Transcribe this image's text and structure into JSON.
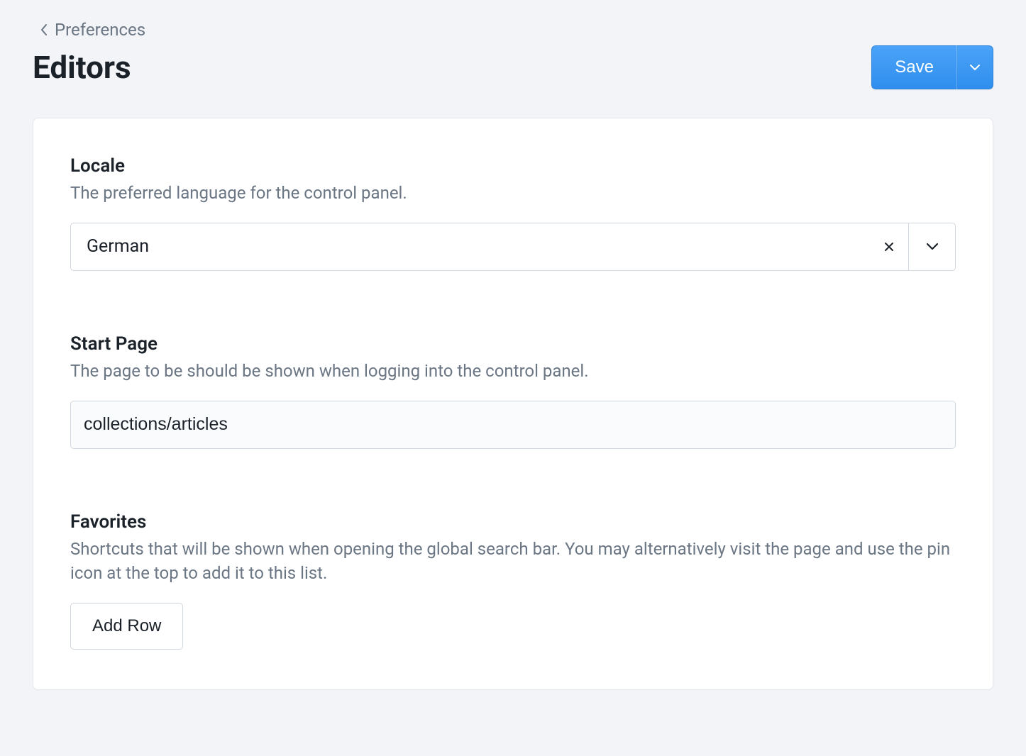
{
  "breadcrumb": {
    "parent_label": "Preferences"
  },
  "header": {
    "title": "Editors",
    "save_label": "Save"
  },
  "fields": {
    "locale": {
      "label": "Locale",
      "help": "The preferred language for the control panel.",
      "value": "German"
    },
    "start_page": {
      "label": "Start Page",
      "help": "The page to be should be shown when logging into the control panel.",
      "value": "collections/articles"
    },
    "favorites": {
      "label": "Favorites",
      "help": "Shortcuts that will be shown when opening the global search bar. You may alternatively visit the page and use the pin icon at the top to add it to this list.",
      "add_row_label": "Add Row"
    }
  }
}
